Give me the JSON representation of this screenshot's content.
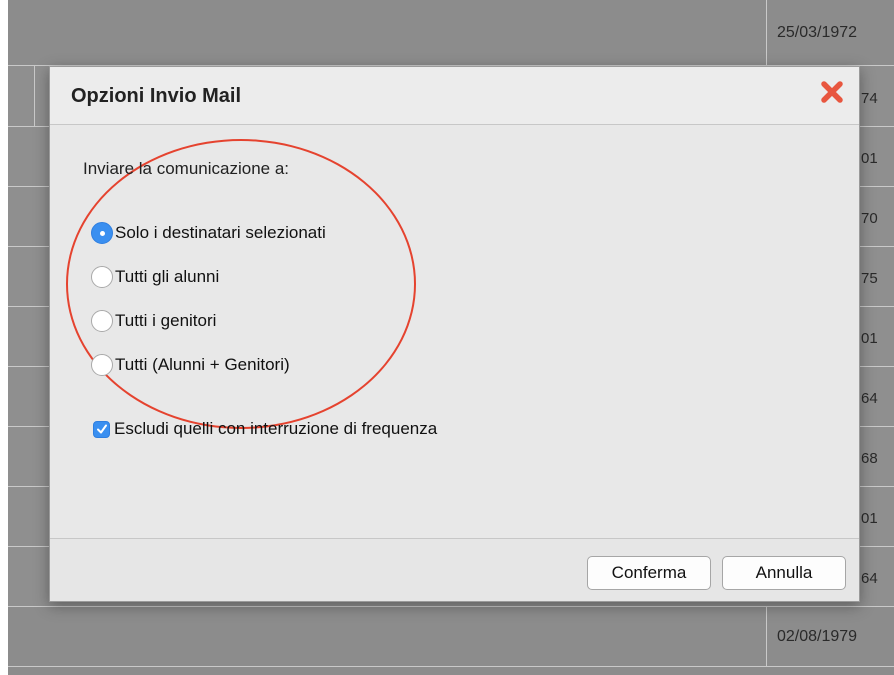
{
  "background": {
    "rows": [
      {
        "date": "25/03/1972"
      },
      {
        "date": "74"
      },
      {
        "date": "01"
      },
      {
        "date": "70"
      },
      {
        "date": "75"
      },
      {
        "date": "01"
      },
      {
        "date": "64"
      },
      {
        "date": "68"
      },
      {
        "date": "01"
      },
      {
        "date": "64"
      },
      {
        "date": "02/08/1979"
      }
    ]
  },
  "dialog": {
    "title": "Opzioni Invio Mail",
    "close_icon": "close-x-icon",
    "prompt": "Inviare la comunicazione a:",
    "options": [
      {
        "label": "Solo i destinatari selezionati",
        "checked": true
      },
      {
        "label": "Tutti gli alunni",
        "checked": false
      },
      {
        "label": "Tutti i genitori",
        "checked": false
      },
      {
        "label": "Tutti (Alunni + Genitori)",
        "checked": false
      }
    ],
    "exclude_checkbox": {
      "label": "Escludi quelli con interruzione di frequenza",
      "checked": true
    },
    "buttons": {
      "confirm": "Conferma",
      "cancel": "Annulla"
    }
  },
  "colors": {
    "accent": "#3a8ff0",
    "annotation": "#e5432f",
    "close": "#e8563f"
  }
}
